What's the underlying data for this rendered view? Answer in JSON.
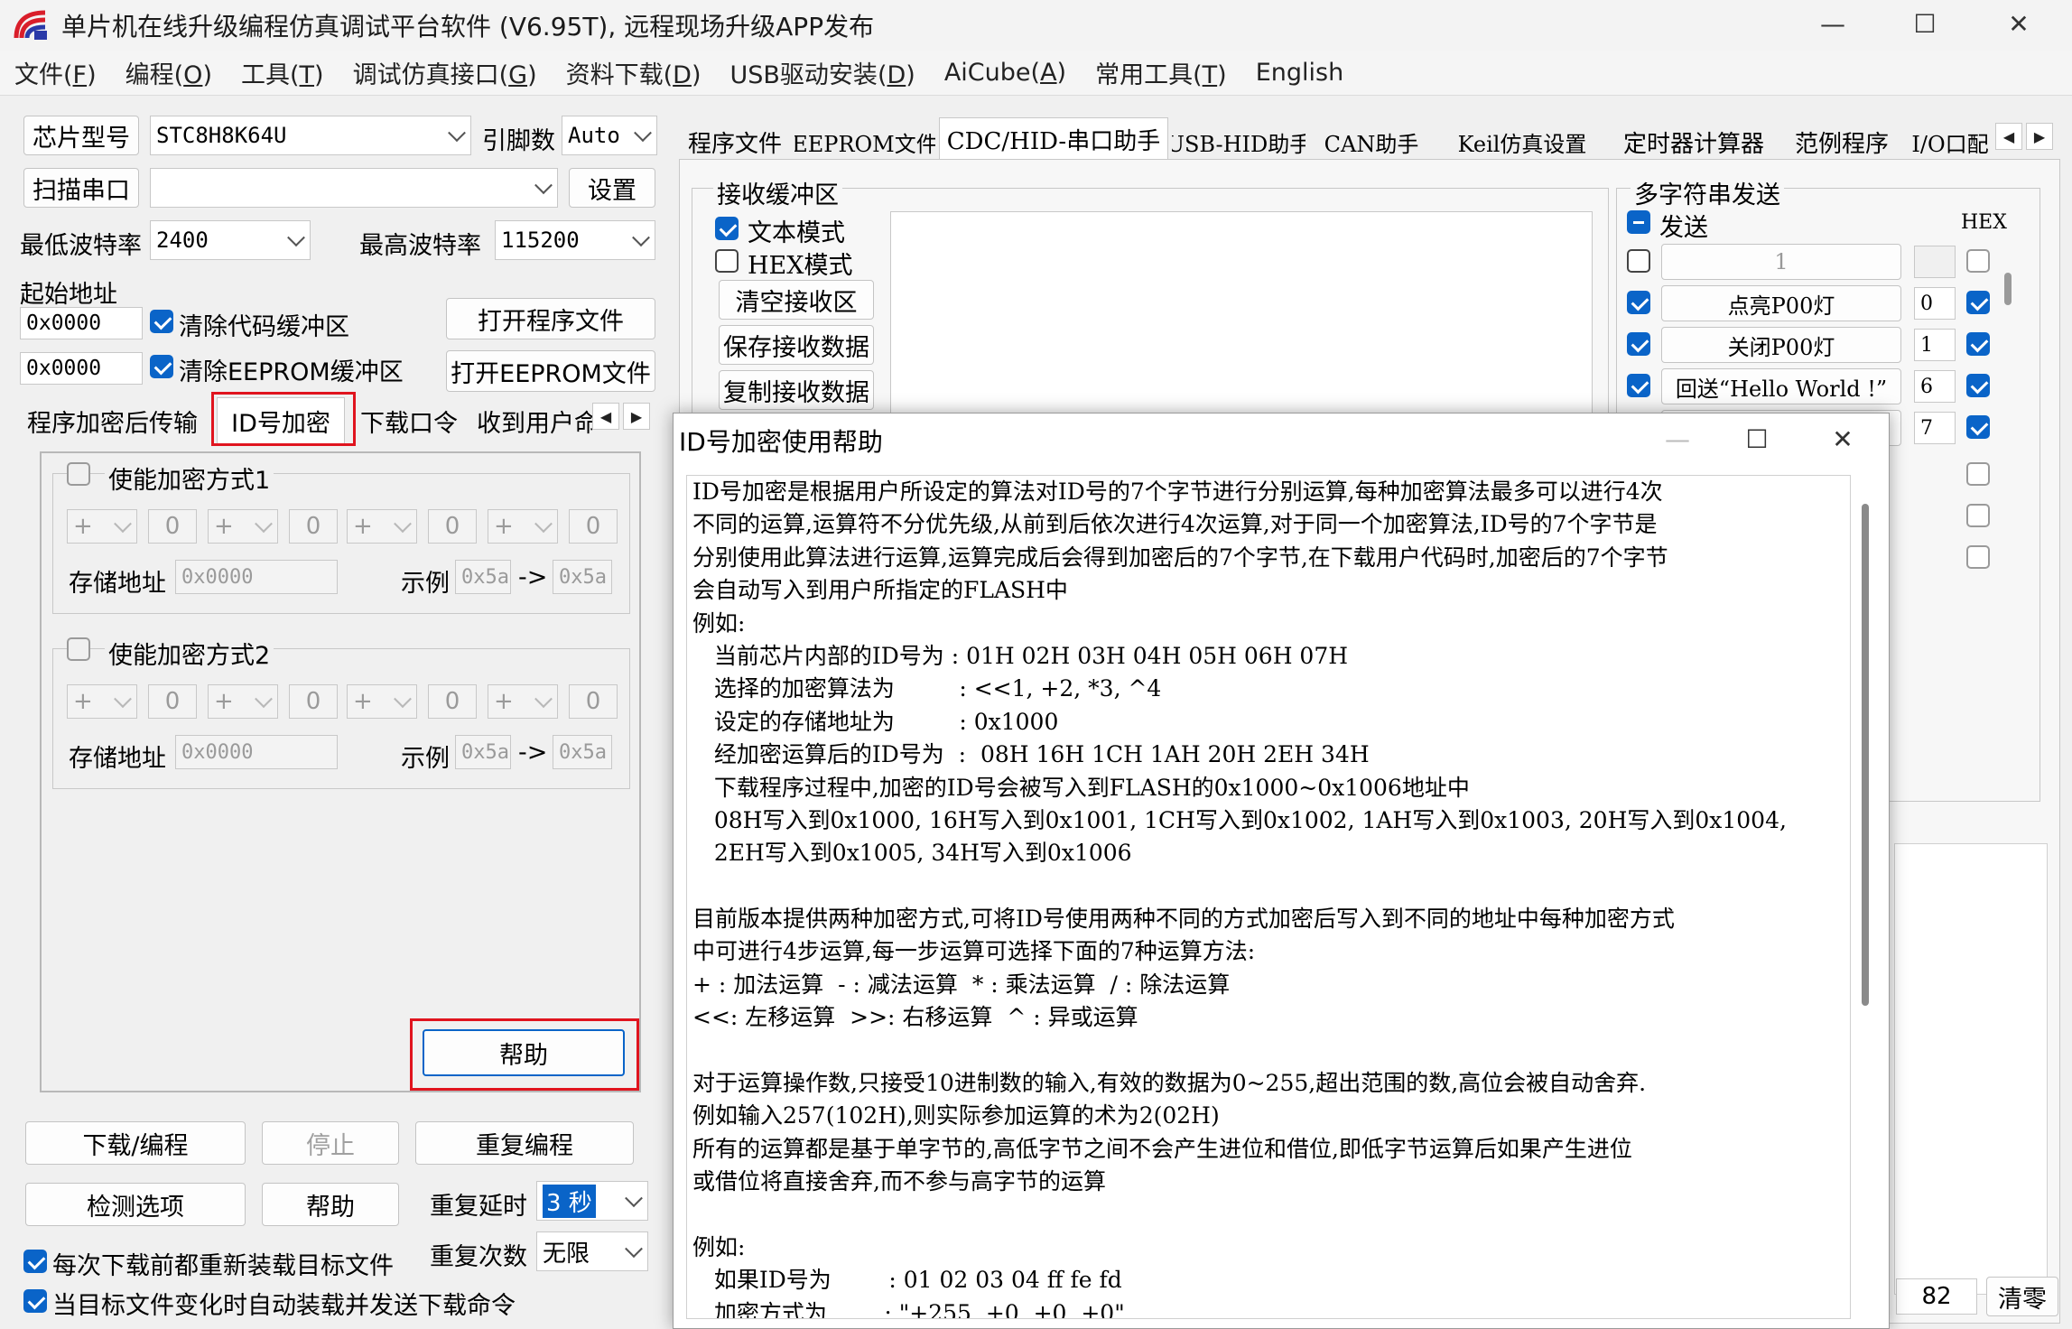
{
  "window": {
    "title": "单片机在线升级编程仿真调试平台软件 (V6.95T), 远程现场升级APP发布",
    "controls": [
      "—",
      "☐",
      "✕"
    ]
  },
  "menu": [
    {
      "text": "文件",
      "key": "F"
    },
    {
      "text": "编程",
      "key": "O"
    },
    {
      "text": "工具",
      "key": "T"
    },
    {
      "text": "调试仿真接口",
      "key": "G"
    },
    {
      "text": "资料下载",
      "key": "D"
    },
    {
      "text": "USB驱动安装",
      "key": "D"
    },
    {
      "text": "AiCube",
      "key": "A"
    },
    {
      "text": "常用工具",
      "key": "T"
    },
    {
      "text": "English",
      "key": ""
    }
  ],
  "left": {
    "chip_button": "芯片型号",
    "chip_value": "STC8H8K64U",
    "pins_label": "引脚数",
    "pins_value": "Auto",
    "scan_button": "扫描串口",
    "port_value": "",
    "settings_button": "设置",
    "min_baud_label": "最低波特率",
    "min_baud_value": "2400",
    "max_baud_label": "最高波特率",
    "max_baud_value": "115200",
    "start_addr_label": "起始地址",
    "addr1": "0x0000",
    "addr2": "0x0000",
    "clear_code_label": "清除代码缓冲区",
    "clear_eeprom_label": "清除EEPROM缓冲区",
    "open_prog_button": "打开程序文件",
    "open_eeprom_button": "打开EEPROM文件",
    "subtabs": [
      "程序加密后传输",
      "ID号加密",
      "下载口令",
      "收到用户命"
    ],
    "enc1_label": "使能加密方式1",
    "enc2_label": "使能加密方式2",
    "op_symbol": "+",
    "op_value": "0",
    "storage_label": "存储地址",
    "storage_value": "0x0000",
    "example_label": "示例",
    "example_in": "0x5a",
    "example_arrow": "->",
    "example_out": "0x5a",
    "help_button": "帮助",
    "download_button": "下载/编程",
    "stop_button": "停止",
    "reprogram_button": "重复编程",
    "check_options_button": "检测选项",
    "help2_button": "帮助",
    "repeat_delay_label": "重复延时",
    "repeat_delay_value": "3 秒",
    "repeat_count_label": "重复次数",
    "repeat_count_value": "无限",
    "reload_label": "每次下载前都重新装载目标文件",
    "autoload_label": "当目标文件变化时自动装载并发送下载命令"
  },
  "right": {
    "tabs": [
      "程序文件",
      "EEPROM文件",
      "CDC/HID-串口助手",
      "USB-HID助手",
      "CAN助手",
      "Keil仿真设置",
      "定时器计算器",
      "范例程序",
      "I/O口配"
    ],
    "recv_title": "接收缓冲区",
    "text_mode": "文本模式",
    "hex_mode": "HEX模式",
    "clear_recv": "清空接收区",
    "save_recv": "保存接收数据",
    "copy_recv": "复制接收数据",
    "multi_title": "多字符串发送",
    "send_label": "发送",
    "hex_label": "HEX",
    "rows": [
      {
        "label": "1",
        "value": ""
      },
      {
        "label": "点亮P00灯",
        "value": "0"
      },
      {
        "label": "关闭P00灯",
        "value": "1"
      },
      {
        "label": "回送“Hello World !”",
        "value": "6"
      },
      {
        "label": "",
        "value": "7"
      }
    ],
    "count_value": "82",
    "clear_button": "清零"
  },
  "dialog": {
    "title": "ID号加密使用帮助",
    "controls": [
      "—",
      "☐",
      "✕"
    ],
    "lines": [
      "ID号加密是根据用户所设定的算法对ID号的7个字节进行分别运算,每种加密算法最多可以进行4次",
      "不同的运算,运算符不分优先级,从前到后依次进行4次运算,对于同一个加密算法,ID号的7个字节是",
      "分别使用此算法进行运算,运算完成后会得到加密后的7个字节,在下载用户代码时,加密后的7个字节",
      "会自动写入到用户所指定的FLASH中",
      "例如:",
      "   当前芯片内部的ID号为 : 01H 02H 03H 04H 05H 06H 07H",
      "   选择的加密算法为         : <<1, +2, *3, ^4",
      "   设定的存储地址为         : 0x1000",
      "   经加密运算后的ID号为  :  08H 16H 1CH 1AH 20H 2EH 34H",
      "   下载程序过程中,加密的ID号会被写入到FLASH的0x1000~0x1006地址中",
      "   08H写入到0x1000, 16H写入到0x1001, 1CH写入到0x1002, 1AH写入到0x1003, 20H写入到0x1004,",
      "   2EH写入到0x1005, 34H写入到0x1006",
      "",
      "目前版本提供两种加密方式,可将ID号使用两种不同的方式加密后写入到不同的地址中每种加密方式",
      "中可进行4步运算,每一步运算可选择下面的7种运算方法:",
      "+ : 加法运算  - : 减法运算  * : 乘法运算  / : 除法运算",
      "<<: 左移运算  >>: 右移运算  ^ : 异或运算",
      "",
      "对于运算操作数,只接受10进制数的输入,有效的数据为0~255,超出范围的数,高位会被自动舍弃.",
      "例如输入257(102H),则实际参加运算的术为2(02H)",
      "所有的运算都是基于单字节的,高低字节之间不会产生进位和借位,即低字节运算后如果产生进位",
      "或借位将直接舍弃,而不参与高字节的运算",
      "",
      "例如:",
      "   如果ID号为        : 01 02 03 04 ff fe fd",
      "   加密方式为        : \"+255, +0, +0, +0\""
    ]
  }
}
